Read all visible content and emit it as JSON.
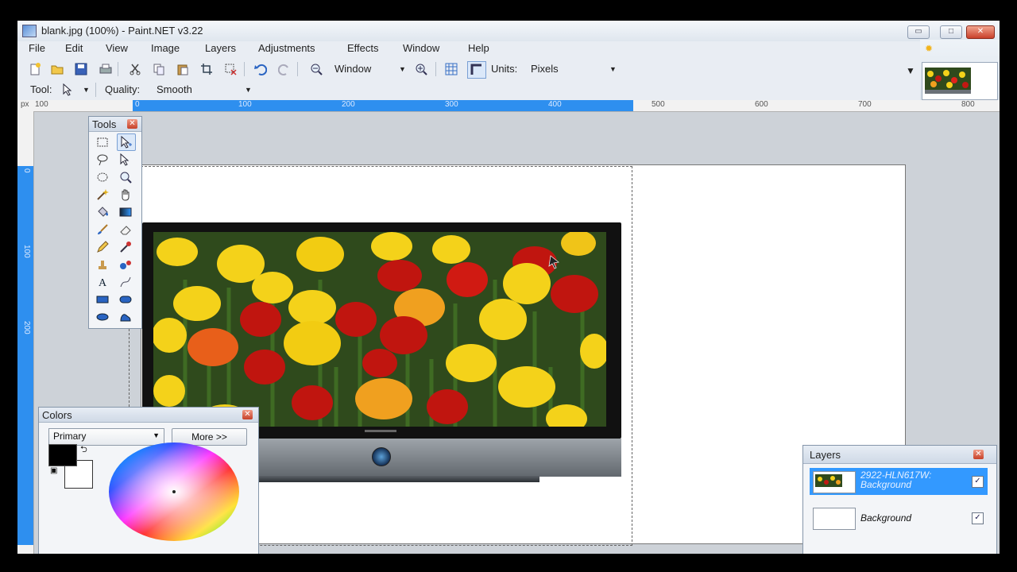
{
  "window": {
    "title": "blank.jpg (100%) - Paint.NET v3.22",
    "controls": {
      "minimize": "▭",
      "maximize": "□",
      "close": "✕"
    }
  },
  "menu": [
    "File",
    "Edit",
    "View",
    "Image",
    "Layers",
    "Adjustments",
    "Effects",
    "Window",
    "Help"
  ],
  "toolbar": {
    "zoom_value": "Window",
    "units_label": "Units:",
    "units_value": "Pixels",
    "tool_label": "Tool:",
    "quality_label": "Quality:",
    "quality_value": "Smooth"
  },
  "ruler": {
    "unit": "px",
    "h_labels": [
      "100",
      "0",
      "100",
      "200",
      "300",
      "400",
      "500",
      "600",
      "700",
      "800"
    ],
    "v_labels": [
      "0",
      "100",
      "200"
    ]
  },
  "tools_panel": {
    "title": "Tools",
    "tools": [
      "rectangle-select",
      "move-selection",
      "lasso-select",
      "move-selected-pixels",
      "ellipse-select",
      "zoom",
      "magic-wand",
      "pan",
      "paint-bucket",
      "gradient",
      "paintbrush",
      "eraser",
      "pencil",
      "color-picker",
      "clone-stamp",
      "recolor",
      "text",
      "line-curve",
      "rectangle",
      "rounded-rectangle",
      "ellipse",
      "freeform-shape"
    ]
  },
  "colors_panel": {
    "title": "Colors",
    "mode": "Primary",
    "more_button": "More >>",
    "primary_color": "#000000",
    "secondary_color": "#ffffff"
  },
  "layers_panel": {
    "title": "Layers",
    "layers": [
      {
        "name": "2922-HLN617W: Background",
        "visible": true,
        "selected": true
      },
      {
        "name": "Background",
        "visible": true,
        "selected": false
      }
    ]
  },
  "colors": {
    "accent": "#2e8fef",
    "selection": "#3399ff",
    "close_red": "#c9402a"
  }
}
